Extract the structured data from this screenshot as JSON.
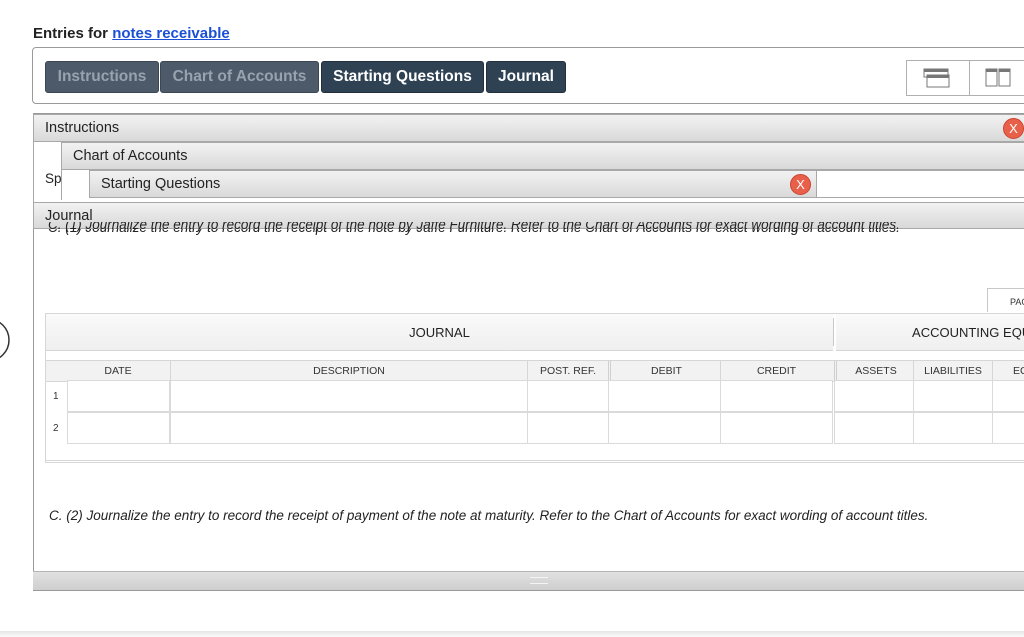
{
  "title": {
    "prefix": "Entries for",
    "link": "notes receivable"
  },
  "tabs": [
    {
      "label": "Instructions",
      "state": "dim"
    },
    {
      "label": "Chart of Accounts",
      "state": "dim"
    },
    {
      "label": "Starting Questions",
      "state": "active"
    },
    {
      "label": "Journal",
      "state": "active"
    }
  ],
  "panels": {
    "instructions": "Instructions",
    "chart_of_accounts": "Chart of Accounts",
    "starting_questions": "Starting Questions",
    "journal": "Journal",
    "hidden_prefix": "Sp"
  },
  "close_label": "X",
  "question1": "C. (1) Journalize the entry to record the receipt of the note by Jaffe Furniture. Refer to the Chart of Accounts for exact wording of account titles.",
  "question2": "C. (2) Journalize the entry to record the receipt of payment of the note at maturity. Refer to the Chart of Accounts for exact wording of account titles.",
  "page_tab": "PAG",
  "journal_table": {
    "section_journal": "JOURNAL",
    "section_equation": "ACCOUNTING EQUATION",
    "columns": [
      "DATE",
      "DESCRIPTION",
      "POST. REF.",
      "DEBIT",
      "CREDIT",
      "ASSETS",
      "LIABILITIES",
      "EC"
    ],
    "rows": [
      "1",
      "2"
    ]
  }
}
